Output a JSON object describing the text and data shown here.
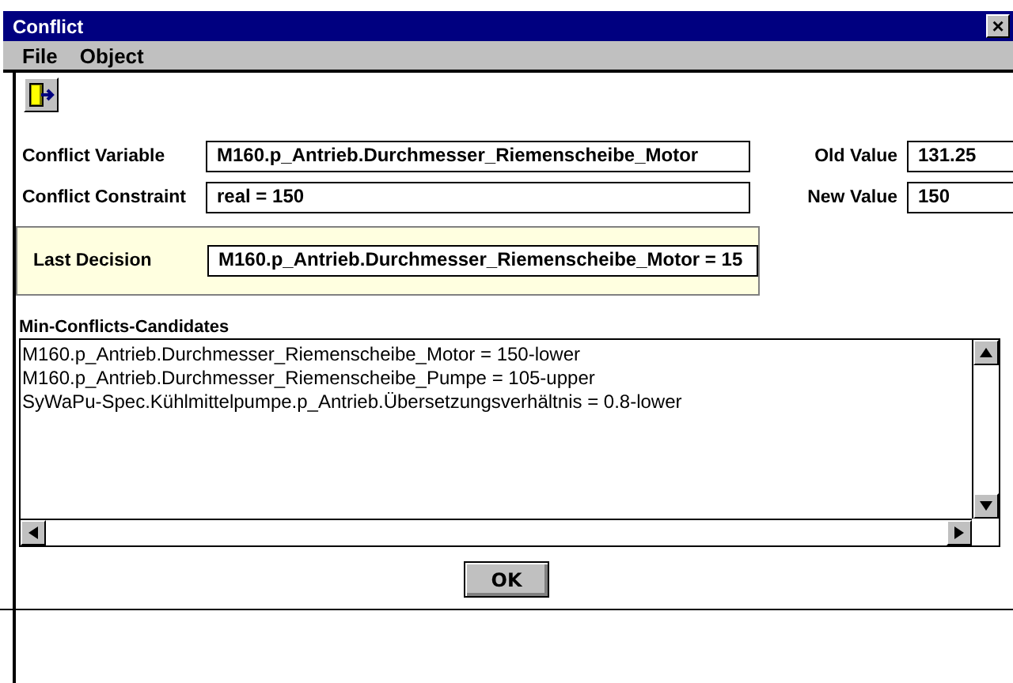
{
  "window": {
    "title": "Conflict",
    "close": "×"
  },
  "menu": [
    "File",
    "Object"
  ],
  "fields_left": [
    {
      "label": "Conflict Variable",
      "value": "M160.p_Antrieb.Durchmesser_Riemenscheibe_Motor"
    },
    {
      "label": "Conflict Constraint",
      "value": "real  = 150"
    }
  ],
  "fields_right": [
    {
      "label": "Old Value",
      "value": "131.25"
    },
    {
      "label": "New Value",
      "value": "150"
    }
  ],
  "last_decision": {
    "label": "Last Decision",
    "value": "M160.p_Antrieb.Durchmesser_Riemenscheibe_Motor = 15"
  },
  "candidates": {
    "label": "Min-Conflicts-Candidates",
    "items": [
      "M160.p_Antrieb.Durchmesser_Riemenscheibe_Motor = 150-lower",
      "M160.p_Antrieb.Durchmesser_Riemenscheibe_Pumpe = 105-upper",
      "SyWaPu-Spec.Kühlmittelpumpe.p_Antrieb.Übersetzungsverhältnis = 0.8-lower"
    ]
  },
  "buttons": [
    "OK"
  ]
}
